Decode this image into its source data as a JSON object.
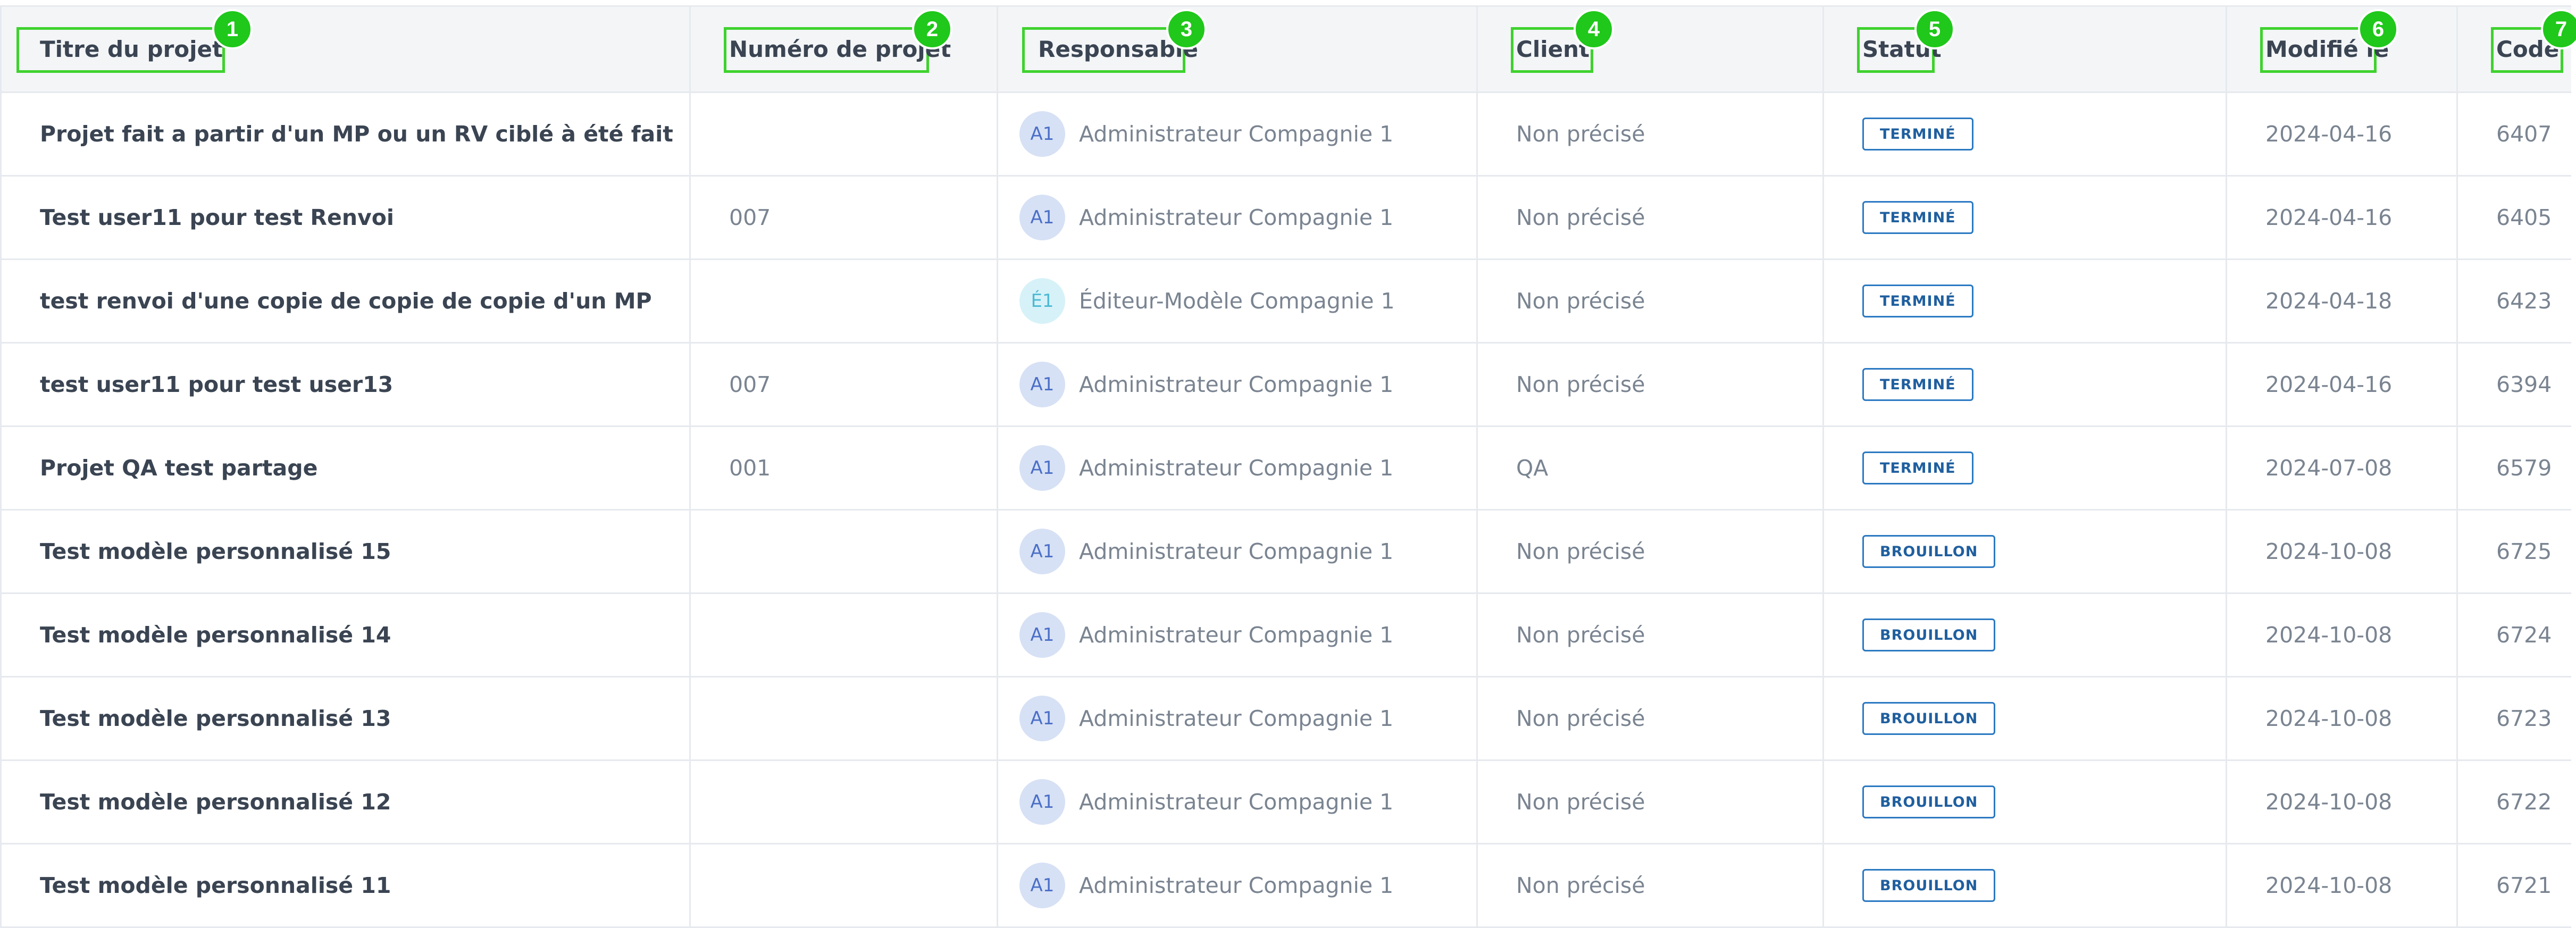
{
  "table": {
    "headers": {
      "title": "Titre du projet",
      "number": "Numéro de projet",
      "owner": "Responsable",
      "client": "Client",
      "status": "Statut",
      "modified": "Modifié le",
      "code": "Code"
    },
    "markers": [
      "1",
      "2",
      "3",
      "4",
      "5",
      "6",
      "7"
    ],
    "rows": [
      {
        "title": "Projet fait a partir d'un MP ou un RV ciblé à été fait",
        "number": "",
        "avatar": "A1",
        "owner": "Administrateur Compagnie 1",
        "client": "Non précisé",
        "status": "TERMINÉ",
        "modified": "2024-04-16",
        "code": "6407"
      },
      {
        "title": "Test user11 pour test Renvoi",
        "number": "007",
        "avatar": "A1",
        "owner": "Administrateur Compagnie 1",
        "client": "Non précisé",
        "status": "TERMINÉ",
        "modified": "2024-04-16",
        "code": "6405"
      },
      {
        "title": "test renvoi d'une copie de copie de copie d'un MP",
        "number": "",
        "avatar": "É1",
        "owner": "Éditeur-Modèle Compagnie 1",
        "client": "Non précisé",
        "status": "TERMINÉ",
        "modified": "2024-04-18",
        "code": "6423"
      },
      {
        "title": "test user11 pour test user13",
        "number": "007",
        "avatar": "A1",
        "owner": "Administrateur Compagnie 1",
        "client": "Non précisé",
        "status": "TERMINÉ",
        "modified": "2024-04-16",
        "code": "6394"
      },
      {
        "title": "Projet QA test partage",
        "number": "001",
        "avatar": "A1",
        "owner": "Administrateur Compagnie 1",
        "client": "QA",
        "status": "TERMINÉ",
        "modified": "2024-07-08",
        "code": "6579"
      },
      {
        "title": "Test modèle personnalisé 15",
        "number": "",
        "avatar": "A1",
        "owner": "Administrateur Compagnie 1",
        "client": "Non précisé",
        "status": "BROUILLON",
        "modified": "2024-10-08",
        "code": "6725"
      },
      {
        "title": "Test modèle personnalisé 14",
        "number": "",
        "avatar": "A1",
        "owner": "Administrateur Compagnie 1",
        "client": "Non précisé",
        "status": "BROUILLON",
        "modified": "2024-10-08",
        "code": "6724"
      },
      {
        "title": "Test modèle personnalisé 13",
        "number": "",
        "avatar": "A1",
        "owner": "Administrateur Compagnie 1",
        "client": "Non précisé",
        "status": "BROUILLON",
        "modified": "2024-10-08",
        "code": "6723"
      },
      {
        "title": "Test modèle personnalisé 12",
        "number": "",
        "avatar": "A1",
        "owner": "Administrateur Compagnie 1",
        "client": "Non précisé",
        "status": "BROUILLON",
        "modified": "2024-10-08",
        "code": "6722"
      },
      {
        "title": "Test modèle personnalisé 11",
        "number": "",
        "avatar": "A1",
        "owner": "Administrateur Compagnie 1",
        "client": "Non précisé",
        "status": "BROUILLON",
        "modified": "2024-10-08",
        "code": "6721"
      }
    ]
  }
}
